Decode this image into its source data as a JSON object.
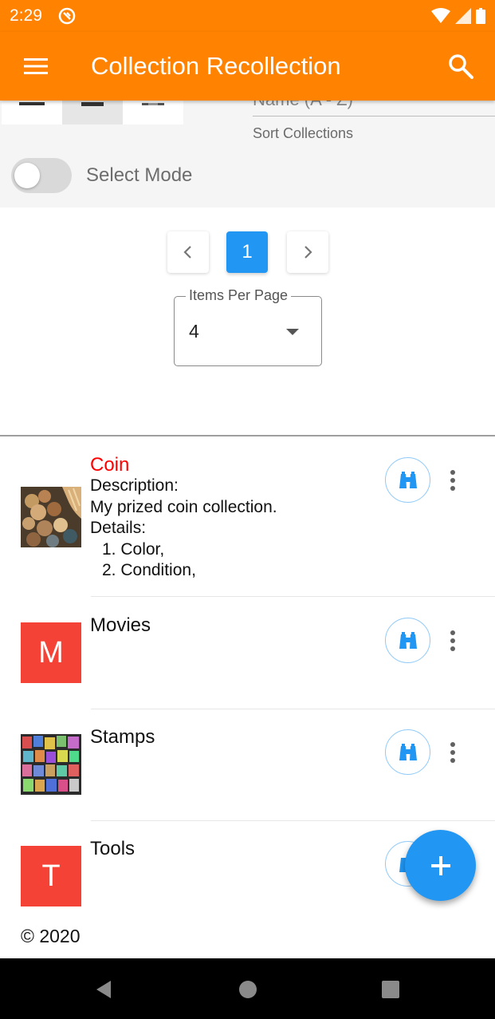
{
  "status_bar": {
    "time": "2:29",
    "bg_color": "#ff8200"
  },
  "app_bar": {
    "title": "Collection Recollection",
    "menu_icon": "menu-icon",
    "search_icon": "search-icon"
  },
  "toolbar": {
    "sort_value_partial": "Name (A - Z)",
    "sort_label": "Sort Collections",
    "select_mode_label": "Select Mode",
    "select_mode_on": false
  },
  "pagination": {
    "current_page": "1",
    "prev_icon": "chevron-left-icon",
    "next_icon": "chevron-right-icon"
  },
  "items_per_page": {
    "label": "Items Per Page",
    "value": "4"
  },
  "collections": [
    {
      "title": "Coin",
      "title_color": "#ff0000",
      "desc_label": "Description:",
      "description": "My prized coin collection.",
      "details_label": "Details:",
      "details": [
        "1. Color,",
        "2. Condition,"
      ]
    },
    {
      "title": "Movies",
      "letter": "M"
    },
    {
      "title": "Stamps"
    },
    {
      "title": "Tools",
      "letter": "T"
    }
  ],
  "footer": {
    "copyright": "© 2020"
  },
  "fab_icon": "plus-icon",
  "accent_color": "#2196f3",
  "avatar_color": "#f44336"
}
